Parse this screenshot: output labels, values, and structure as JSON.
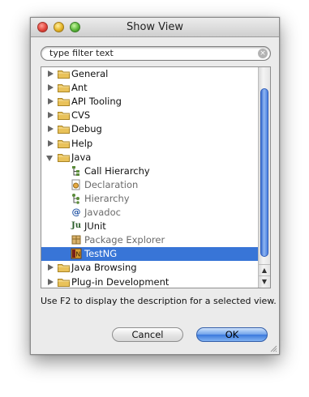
{
  "window": {
    "title": "Show View"
  },
  "search": {
    "value": "type filter text"
  },
  "tree": {
    "items": [
      {
        "label": "General",
        "kind": "category",
        "expanded": false
      },
      {
        "label": "Ant",
        "kind": "category",
        "expanded": false
      },
      {
        "label": "API Tooling",
        "kind": "category",
        "expanded": false
      },
      {
        "label": "CVS",
        "kind": "category",
        "expanded": false
      },
      {
        "label": "Debug",
        "kind": "category",
        "expanded": false
      },
      {
        "label": "Help",
        "kind": "category",
        "expanded": false
      },
      {
        "label": "Java",
        "kind": "category",
        "expanded": true
      },
      {
        "label": "Call Hierarchy",
        "kind": "view",
        "icon": "call-hierarchy-icon"
      },
      {
        "label": "Declaration",
        "kind": "view",
        "icon": "declaration-icon",
        "dim": true
      },
      {
        "label": "Hierarchy",
        "kind": "view",
        "icon": "hierarchy-icon",
        "dim": true
      },
      {
        "label": "Javadoc",
        "kind": "view",
        "icon": "javadoc-icon",
        "dim": true
      },
      {
        "label": "JUnit",
        "kind": "view",
        "icon": "junit-icon"
      },
      {
        "label": "Package Explorer",
        "kind": "view",
        "icon": "package-explorer-icon",
        "dim": true
      },
      {
        "label": "TestNG",
        "kind": "view",
        "icon": "testng-icon",
        "selected": true
      },
      {
        "label": "Java Browsing",
        "kind": "category",
        "expanded": false
      },
      {
        "label": "Plug-in Development",
        "kind": "category",
        "expanded": false
      }
    ]
  },
  "description": "Use F2 to display the description for a selected view.",
  "buttons": {
    "cancel": "Cancel",
    "ok": "OK"
  },
  "colors": {
    "selection": "#3875d7",
    "folder": "#e9c25a"
  },
  "icons": {
    "javadoc": "@",
    "junit": "Ju",
    "scroll_up": "▲",
    "scroll_down": "▼",
    "clear": "×"
  }
}
